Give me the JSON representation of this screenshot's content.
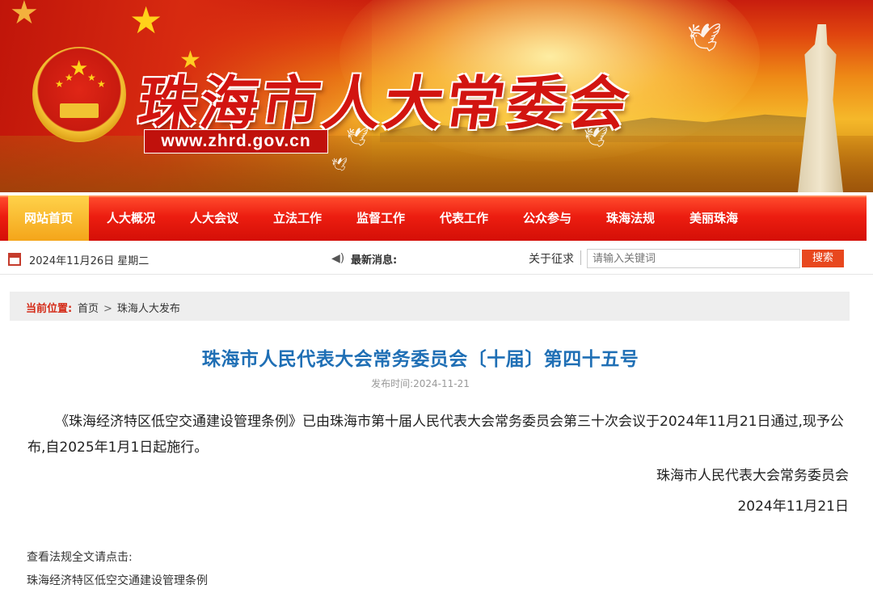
{
  "header": {
    "site_title": "珠海市人大常委会",
    "site_url": "www.zhrd.gov.cn"
  },
  "nav": {
    "items": [
      {
        "label": "网站首页",
        "active": true
      },
      {
        "label": "人大概况"
      },
      {
        "label": "人大会议"
      },
      {
        "label": "立法工作"
      },
      {
        "label": "监督工作"
      },
      {
        "label": "代表工作"
      },
      {
        "label": "公众参与"
      },
      {
        "label": "珠海法规"
      },
      {
        "label": "美丽珠海"
      }
    ]
  },
  "infobar": {
    "date": "2024年11月26日 星期二",
    "news_label": "最新消息:",
    "collect_label": "关于征求",
    "search_placeholder": "请输入关键词",
    "search_button": "搜索"
  },
  "breadcrumb": {
    "label": "当前位置:",
    "items": [
      "首页",
      "珠海人大发布"
    ],
    "separator": ">"
  },
  "article": {
    "title": "珠海市人民代表大会常务委员会〔十届〕第四十五号",
    "publish_time": "发布时间:2024-11-21",
    "body": "《珠海经济特区低空交通建设管理条例》已由珠海市第十届人民代表大会常务委员会第三十次会议于2024年11月21日通过,现予公布,自2025年1月1日起施行。",
    "signature_org": "珠海市人民代表大会常务委员会",
    "signature_date": "2024年11月21日",
    "see_full_text": "查看法规全文请点击:",
    "law_link": "珠海经济特区低空交通建设管理条例"
  },
  "colors": {
    "nav_red": "#e01a0e",
    "nav_active": "#f4a51a",
    "title_blue": "#1f6fb5",
    "breadcrumb_label": "#d42b18",
    "search_button": "#e8471e"
  }
}
